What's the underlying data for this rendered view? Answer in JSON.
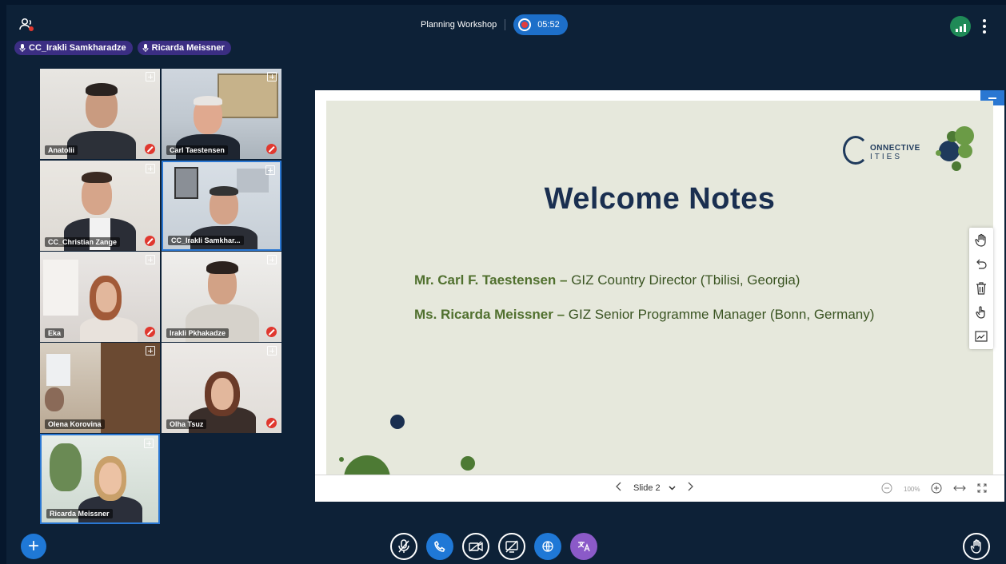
{
  "meeting": {
    "title": "Planning Workshop",
    "timer": "05:52"
  },
  "talkers": [
    {
      "name": "CC_Irakli Samkharadze"
    },
    {
      "name": "Ricarda Meissner"
    }
  ],
  "participants": [
    {
      "name": "Anatolii",
      "muted": true
    },
    {
      "name": "Carl Taestensen",
      "muted": true
    },
    {
      "name": "CC_Christian Zange",
      "muted": true
    },
    {
      "name": "CC_Irakli Samkhar...",
      "muted": false
    },
    {
      "name": "Eka",
      "muted": true
    },
    {
      "name": "Irakli Pkhakadze",
      "muted": true
    },
    {
      "name": "Olena Korovina",
      "muted": false
    },
    {
      "name": "Olha Tsuz",
      "muted": true
    },
    {
      "name": "Ricarda Meissner",
      "muted": false
    }
  ],
  "slide": {
    "logo_line1": "ONNECTIVE",
    "logo_line2": "ITIES",
    "title": "Welcome Notes",
    "line1_bold": "Mr. Carl F. Taestensen –",
    "line1_rest": " GIZ Country Director  (Tbilisi, Georgia)",
    "line2_bold": "Ms. Ricarda Meissner –",
    "line2_rest": " GIZ Senior Programme Manager (Bonn, Germany)",
    "current": "Slide 2",
    "zoom": "100%"
  },
  "colors": {
    "background": "#0d2137",
    "accent_blue": "#1f78d6",
    "talker_pill": "#3b2e83",
    "muted_red": "#e0382f",
    "slide_bg": "#e6e8dc",
    "slide_title": "#1a2f50",
    "slide_green": "#50702e"
  },
  "icons": {
    "top_left": "users-icon",
    "connection": "connection-status-icon",
    "more": "more-vertical-icon",
    "tools": [
      "hand-pan-icon",
      "undo-icon",
      "trash-icon",
      "pointer-hand-icon",
      "whiteboard-icon"
    ],
    "actions": [
      "microphone-muted-icon",
      "phone-audio-icon",
      "camera-off-icon",
      "screen-share-off-icon",
      "globe-icon",
      "translate-icon"
    ],
    "raise_hand": "raise-hand-icon",
    "add": "plus-icon"
  }
}
